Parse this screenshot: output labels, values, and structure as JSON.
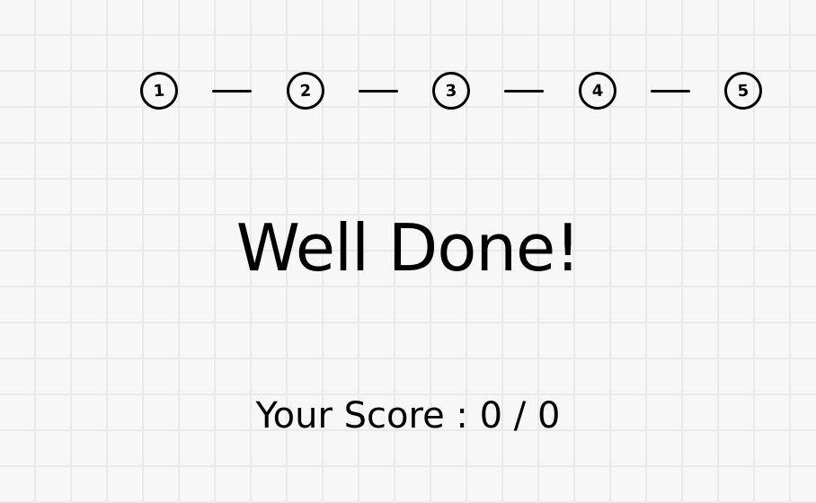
{
  "steps": [
    "1",
    "2",
    "3",
    "4",
    "5"
  ],
  "result": {
    "title": "Well Done!",
    "score_label": "Your Score",
    "score_separator": ":",
    "score_value": "0",
    "score_divider": "/",
    "score_total": "0"
  }
}
